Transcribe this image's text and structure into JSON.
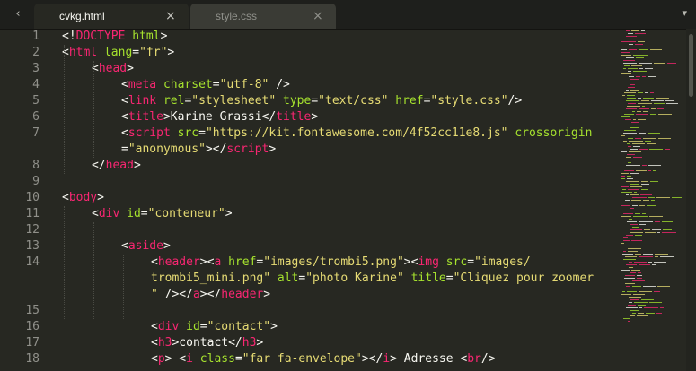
{
  "tabs": [
    {
      "label": "cvkg.html",
      "active": true,
      "close_icon": "×"
    },
    {
      "label": "style.css",
      "active": false,
      "close_icon": "×"
    }
  ],
  "nav": {
    "left_icon": "‹",
    "dropdown_icon": "▾"
  },
  "colors": {
    "background": "#272822",
    "tag": "#f92672",
    "attribute": "#a6e22e",
    "string": "#e6db74",
    "text": "#f8f8f2",
    "line_number": "#90908a"
  },
  "line_numbers": [
    "1",
    "2",
    "3",
    "4",
    "5",
    "6",
    "7",
    "8",
    "9",
    "10",
    "11",
    "12",
    "13",
    "14",
    "15",
    "16",
    "17",
    "18"
  ],
  "code_rows": [
    {
      "num": "1",
      "indent": 0,
      "tokens": [
        [
          "txt",
          "<!"
        ],
        [
          "tag",
          "DOCTYPE"
        ],
        [
          "txt",
          " "
        ],
        [
          "attr",
          "html"
        ],
        [
          "txt",
          ">"
        ]
      ]
    },
    {
      "num": "2",
      "indent": 0,
      "tokens": [
        [
          "txt",
          "<"
        ],
        [
          "tag",
          "html"
        ],
        [
          "txt",
          " "
        ],
        [
          "attr",
          "lang"
        ],
        [
          "txt",
          "="
        ],
        [
          "str",
          "\"fr\""
        ],
        [
          "txt",
          ">"
        ]
      ]
    },
    {
      "num": "3",
      "indent": 1,
      "tokens": [
        [
          "txt",
          "<"
        ],
        [
          "tag",
          "head"
        ],
        [
          "txt",
          ">"
        ]
      ]
    },
    {
      "num": "4",
      "indent": 2,
      "tokens": [
        [
          "txt",
          "<"
        ],
        [
          "tag",
          "meta"
        ],
        [
          "txt",
          " "
        ],
        [
          "attr",
          "charset"
        ],
        [
          "txt",
          "="
        ],
        [
          "str",
          "\"utf-8\""
        ],
        [
          "txt",
          " />"
        ]
      ]
    },
    {
      "num": "5",
      "indent": 2,
      "tokens": [
        [
          "txt",
          "<"
        ],
        [
          "tag",
          "link"
        ],
        [
          "txt",
          " "
        ],
        [
          "attr",
          "rel"
        ],
        [
          "txt",
          "="
        ],
        [
          "str",
          "\"stylesheet\""
        ],
        [
          "txt",
          " "
        ],
        [
          "attr",
          "type"
        ],
        [
          "txt",
          "="
        ],
        [
          "str",
          "\"text/css\""
        ],
        [
          "txt",
          " "
        ],
        [
          "attr",
          "href"
        ],
        [
          "txt",
          "="
        ],
        [
          "str",
          "\"style.css\""
        ],
        [
          "txt",
          "/>"
        ]
      ]
    },
    {
      "num": "6",
      "indent": 2,
      "tokens": [
        [
          "txt",
          "<"
        ],
        [
          "tag",
          "title"
        ],
        [
          "txt",
          ">Karine Grassi</"
        ],
        [
          "tag",
          "title"
        ],
        [
          "txt",
          ">"
        ]
      ]
    },
    {
      "num": "7",
      "indent": 2,
      "tokens": [
        [
          "txt",
          "<"
        ],
        [
          "tag",
          "script"
        ],
        [
          "txt",
          " "
        ],
        [
          "attr",
          "src"
        ],
        [
          "txt",
          "="
        ],
        [
          "str",
          "\"https://kit.fontawesome.com/4f52cc11e8.js\""
        ],
        [
          "txt",
          " "
        ],
        [
          "attr",
          "crossorigin"
        ]
      ]
    },
    {
      "num": "",
      "indent": 2,
      "tokens": [
        [
          "txt",
          "="
        ],
        [
          "str",
          "\"anonymous\""
        ],
        [
          "txt",
          "></"
        ],
        [
          "tag",
          "script"
        ],
        [
          "txt",
          ">"
        ]
      ]
    },
    {
      "num": "8",
      "indent": 1,
      "tokens": [
        [
          "txt",
          "</"
        ],
        [
          "tag",
          "head"
        ],
        [
          "txt",
          ">"
        ]
      ]
    },
    {
      "num": "9",
      "indent": 0,
      "tokens": []
    },
    {
      "num": "10",
      "indent": 0,
      "tokens": [
        [
          "txt",
          "<"
        ],
        [
          "tag",
          "body"
        ],
        [
          "txt",
          ">"
        ]
      ]
    },
    {
      "num": "11",
      "indent": 1,
      "tokens": [
        [
          "txt",
          "<"
        ],
        [
          "tag",
          "div"
        ],
        [
          "txt",
          " "
        ],
        [
          "attr",
          "id"
        ],
        [
          "txt",
          "="
        ],
        [
          "str",
          "\"conteneur\""
        ],
        [
          "txt",
          ">"
        ]
      ]
    },
    {
      "num": "12",
      "indent": 0,
      "tokens": []
    },
    {
      "num": "13",
      "indent": 2,
      "tokens": [
        [
          "txt",
          "<"
        ],
        [
          "tag",
          "aside"
        ],
        [
          "txt",
          ">"
        ]
      ]
    },
    {
      "num": "14",
      "indent": 3,
      "tokens": [
        [
          "txt",
          "<"
        ],
        [
          "tag",
          "header"
        ],
        [
          "txt",
          "><"
        ],
        [
          "tag",
          "a"
        ],
        [
          "txt",
          " "
        ],
        [
          "attr",
          "href"
        ],
        [
          "txt",
          "="
        ],
        [
          "str",
          "\"images/trombi5.png\""
        ],
        [
          "txt",
          "><"
        ],
        [
          "tag",
          "img"
        ],
        [
          "txt",
          " "
        ],
        [
          "attr",
          "src"
        ],
        [
          "txt",
          "="
        ],
        [
          "str",
          "\"images/"
        ]
      ]
    },
    {
      "num": "",
      "indent": 3,
      "tokens": [
        [
          "str",
          "trombi5_mini.png\""
        ],
        [
          "txt",
          " "
        ],
        [
          "attr",
          "alt"
        ],
        [
          "txt",
          "="
        ],
        [
          "str",
          "\"photo Karine\""
        ],
        [
          "txt",
          " "
        ],
        [
          "attr",
          "title"
        ],
        [
          "txt",
          "="
        ],
        [
          "str",
          "\"Cliquez pour zoomer"
        ]
      ]
    },
    {
      "num": "",
      "indent": 3,
      "tokens": [
        [
          "str",
          "\""
        ],
        [
          "txt",
          " /></"
        ],
        [
          "tag",
          "a"
        ],
        [
          "txt",
          "></"
        ],
        [
          "tag",
          "header"
        ],
        [
          "txt",
          ">"
        ]
      ]
    },
    {
      "num": "15",
      "indent": 0,
      "tokens": []
    },
    {
      "num": "16",
      "indent": 3,
      "tokens": [
        [
          "txt",
          "<"
        ],
        [
          "tag",
          "div"
        ],
        [
          "txt",
          " "
        ],
        [
          "attr",
          "id"
        ],
        [
          "txt",
          "="
        ],
        [
          "str",
          "\"contact\""
        ],
        [
          "txt",
          ">"
        ]
      ]
    },
    {
      "num": "17",
      "indent": 3,
      "tokens": [
        [
          "txt",
          "<"
        ],
        [
          "tag",
          "h3"
        ],
        [
          "txt",
          ">contact</"
        ],
        [
          "tag",
          "h3"
        ],
        [
          "txt",
          ">"
        ]
      ]
    },
    {
      "num": "18",
      "indent": 3,
      "tokens": [
        [
          "txt",
          "<"
        ],
        [
          "tag",
          "p"
        ],
        [
          "txt",
          "> <"
        ],
        [
          "tag",
          "i"
        ],
        [
          "txt",
          " "
        ],
        [
          "attr",
          "class"
        ],
        [
          "txt",
          "="
        ],
        [
          "str",
          "\"far fa-envelope\""
        ],
        [
          "txt",
          "></"
        ],
        [
          "tag",
          "i"
        ],
        [
          "txt",
          "> Adresse <"
        ],
        [
          "tag",
          "br"
        ],
        [
          "txt",
          "/>"
        ]
      ]
    }
  ],
  "minimap_label": "code-minimap",
  "scrollbar_label": "vertical-scrollbar"
}
